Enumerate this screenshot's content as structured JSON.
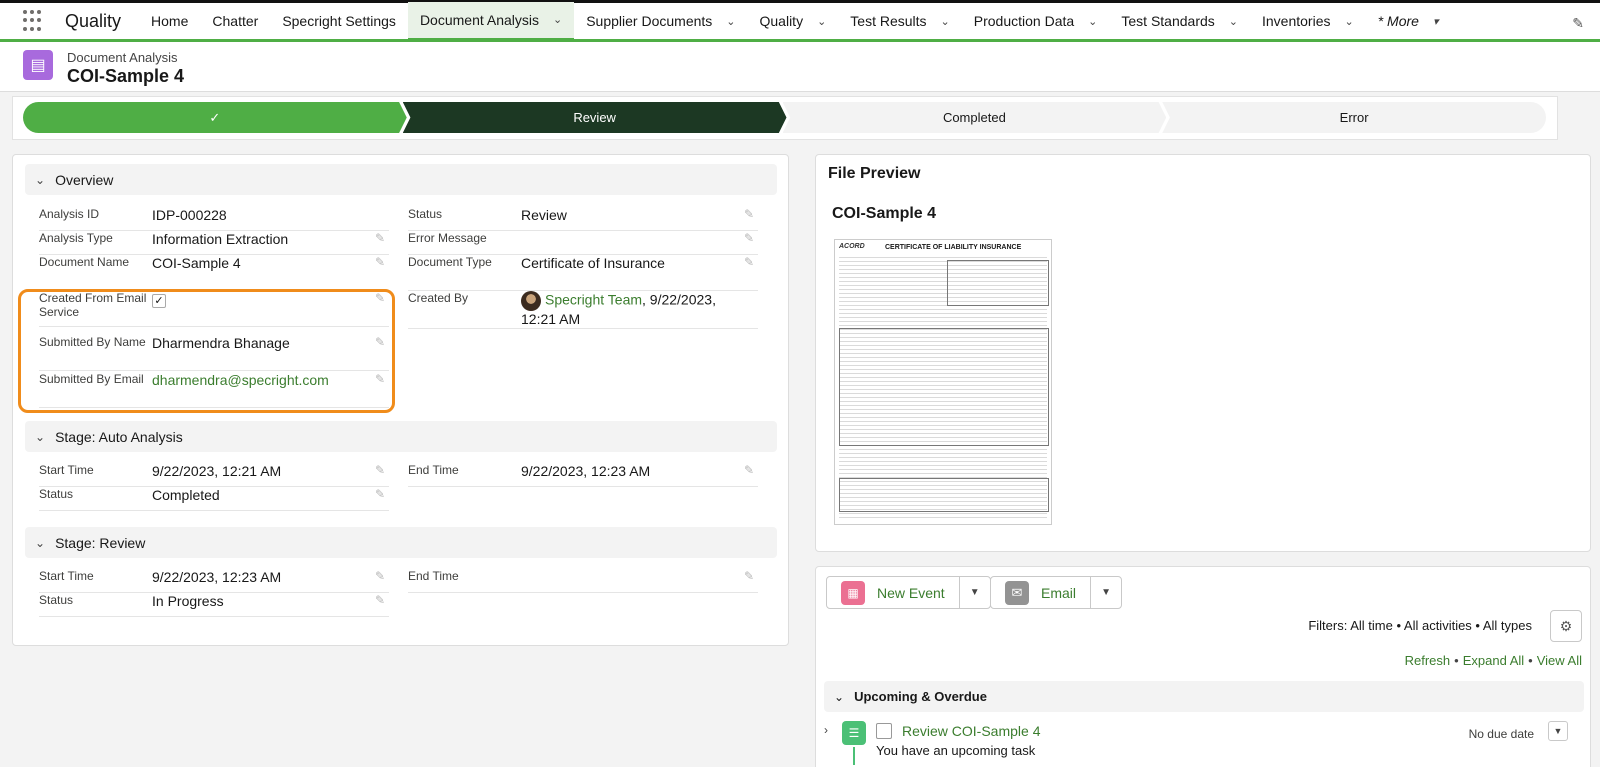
{
  "nav": {
    "app_name": "Quality",
    "items": [
      {
        "label": "Home",
        "dropdown": false
      },
      {
        "label": "Chatter",
        "dropdown": false
      },
      {
        "label": "Specright Settings",
        "dropdown": false
      },
      {
        "label": "Document Analysis",
        "dropdown": true,
        "active": true
      },
      {
        "label": "Supplier Documents",
        "dropdown": true
      },
      {
        "label": "Quality",
        "dropdown": true
      },
      {
        "label": "Test Results",
        "dropdown": true
      },
      {
        "label": "Production Data",
        "dropdown": true
      },
      {
        "label": "Test Standards",
        "dropdown": true
      },
      {
        "label": "Inventories",
        "dropdown": true
      }
    ],
    "more_label": "* More"
  },
  "header": {
    "object_label": "Document Analysis",
    "record_title": "COI-Sample 4"
  },
  "path": {
    "steps": [
      "",
      "Review",
      "Completed",
      "Error"
    ]
  },
  "overview": {
    "section_title": "Overview",
    "analysis_id_label": "Analysis ID",
    "analysis_id": "IDP-000228",
    "analysis_type_label": "Analysis Type",
    "analysis_type": "Information Extraction",
    "document_name_label": "Document Name",
    "document_name": "COI-Sample 4",
    "created_from_email_label": "Created From Email Service",
    "submitted_by_name_label": "Submitted By Name",
    "submitted_by_name": "Dharmendra Bhanage",
    "submitted_by_email_label": "Submitted By Email",
    "submitted_by_email": "dharmendra@specright.com",
    "status_label": "Status",
    "status": "Review",
    "error_message_label": "Error Message",
    "document_type_label": "Document Type",
    "document_type": "Certificate of Insurance",
    "created_by_label": "Created By",
    "created_by_user": "Specright Team",
    "created_by_date": ", 9/22/2023,",
    "created_by_time": "12:21 AM"
  },
  "auto_analysis": {
    "section_title": "Stage: Auto Analysis",
    "start_time_label": "Start Time",
    "start_time": "9/22/2023, 12:21 AM",
    "status_label": "Status",
    "status": "Completed",
    "end_time_label": "End Time",
    "end_time": "9/22/2023, 12:23 AM"
  },
  "review_stage": {
    "section_title": "Stage: Review",
    "start_time_label": "Start Time",
    "start_time": "9/22/2023, 12:23 AM",
    "status_label": "Status",
    "status": "In Progress",
    "end_time_label": "End Time"
  },
  "preview": {
    "title": "File Preview",
    "file_name": "COI-Sample 4",
    "doc_heading": "CERTIFICATE OF LIABILITY INSURANCE",
    "doc_logo": "ACORD"
  },
  "activity": {
    "new_event_label": "New Event",
    "email_label": "Email",
    "filters_text": "Filters: All time • All activities • All types",
    "refresh": "Refresh",
    "expand_all": "Expand All",
    "view_all": "View All",
    "upcoming_title": "Upcoming & Overdue",
    "task_title": "Review COI-Sample 4",
    "task_sub": "You have an upcoming task",
    "task_due": "No due date"
  },
  "colors": {
    "brand_green": "#4fae45",
    "path_current": "#1c3823",
    "highlight_orange": "#f08c1b",
    "link_green": "#3b7d2e",
    "header_icon": "#a86add"
  }
}
